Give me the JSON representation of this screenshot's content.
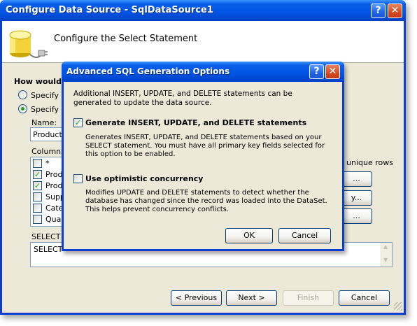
{
  "main_window": {
    "title": "Configure Data Source - SqlDataSource1",
    "heading": "Configure the Select Statement",
    "question": "How would y",
    "radio_specify_custom": "Specify a",
    "radio_specify_columns": "Specify co",
    "name_label": "Name:",
    "name_value": "Products",
    "columns_label": "Columns:",
    "columns": [
      {
        "label": "*",
        "checked": false
      },
      {
        "label": "Produ",
        "checked": true
      },
      {
        "label": "Produ",
        "checked": true
      },
      {
        "label": "Supp",
        "checked": false
      },
      {
        "label": "Cate",
        "checked": false
      },
      {
        "label": "Quan",
        "checked": false
      }
    ],
    "unique_rows_label": "r unique rows",
    "side_buttons": [
      "...",
      "y...",
      "..."
    ],
    "select_statement_label": "SELECT s",
    "select_statement_value": "SELECT",
    "buttons": {
      "previous": "< Previous",
      "next": "Next >",
      "finish": "Finish",
      "cancel": "Cancel"
    }
  },
  "dialog": {
    "title": "Advanced SQL Generation Options",
    "intro": "Additional INSERT, UPDATE, and DELETE statements can be generated to update the data source.",
    "option_generate": {
      "label": "Generate INSERT, UPDATE, and DELETE statements",
      "checked": true,
      "description": "Generates INSERT, UPDATE, and DELETE statements based on your SELECT statement. You must have all primary key fields selected for this option to be enabled."
    },
    "option_optimistic": {
      "label": "Use optimistic concurrency",
      "checked": false,
      "description": "Modifies UPDATE and DELETE statements to detect whether the database has changed since the record was loaded into the DataSet. This helps prevent concurrency conflicts."
    },
    "ok_label": "OK",
    "cancel_label": "Cancel"
  },
  "title_buttons": {
    "help": "?",
    "close": "✕"
  },
  "colors": {
    "titlebar": "#0356e6",
    "face": "#ece9d8",
    "check": "#21a121",
    "close": "#d74b1f"
  }
}
